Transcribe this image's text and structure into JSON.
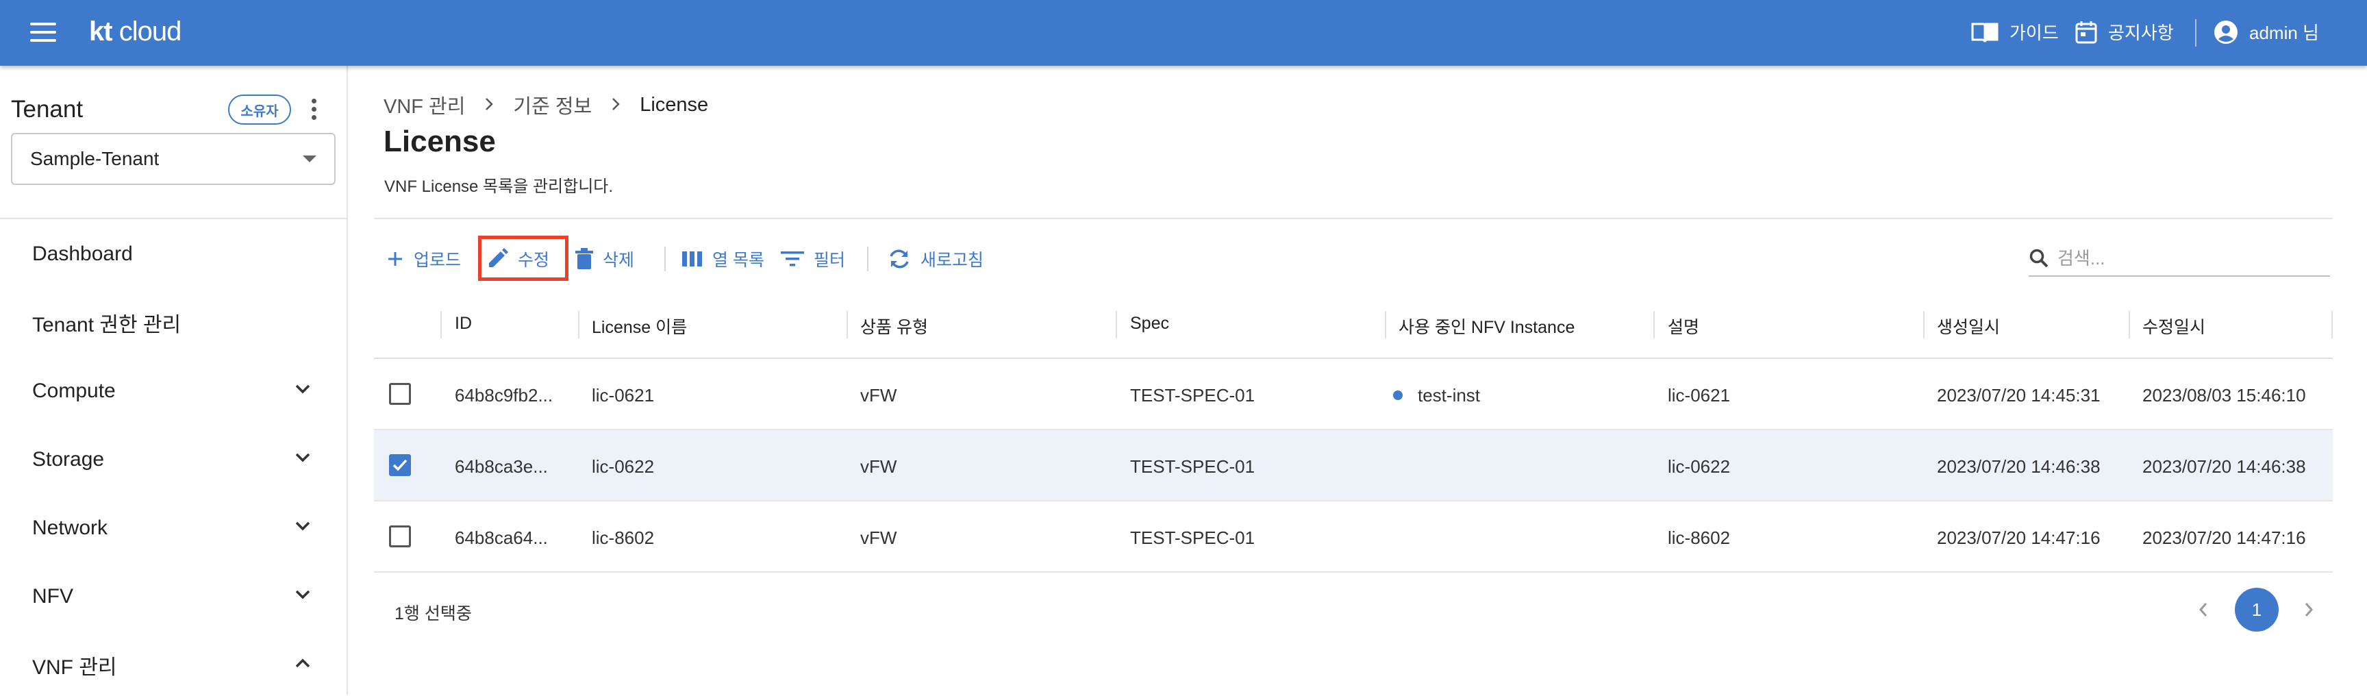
{
  "header": {
    "brand_bold": "kt",
    "brand_light": " cloud",
    "guide": "가이드",
    "notice": "공지사항",
    "user": "admin 님"
  },
  "sidebar": {
    "tenant_title": "Tenant",
    "owner_badge": "소유자",
    "tenant_selected": "Sample-Tenant",
    "items": [
      {
        "label": "Dashboard",
        "expandable": false
      },
      {
        "label": "Tenant 권한 관리",
        "expandable": false
      },
      {
        "label": "Compute",
        "expandable": true,
        "expanded": false
      },
      {
        "label": "Storage",
        "expandable": true,
        "expanded": false
      },
      {
        "label": "Network",
        "expandable": true,
        "expanded": false
      },
      {
        "label": "NFV",
        "expandable": true,
        "expanded": false
      },
      {
        "label": "VNF 관리",
        "expandable": true,
        "expanded": true
      }
    ]
  },
  "breadcrumb": {
    "level1": "VNF 관리",
    "level2": "기준 정보",
    "level3": "License"
  },
  "page": {
    "title": "License",
    "description": "VNF License 목록을 관리합니다."
  },
  "toolbar": {
    "upload": "업로드",
    "edit": "수정",
    "delete": "삭제",
    "columns": "열 목록",
    "filter": "필터",
    "refresh": "새로고침",
    "search_placeholder": "검색..."
  },
  "table": {
    "columns": [
      "ID",
      "License 이름",
      "상품 유형",
      "Spec",
      "사용 중인 NFV Instance",
      "설명",
      "생성일시",
      "수정일시"
    ],
    "rows": [
      {
        "checked": false,
        "id": "64b8c9fb2...",
        "name": "lic-0621",
        "type": "vFW",
        "spec": "TEST-SPEC-01",
        "instance": "test-inst",
        "desc": "lic-0621",
        "created": "2023/07/20 14:45:31",
        "modified": "2023/08/03 15:46:10"
      },
      {
        "checked": true,
        "id": "64b8ca3e...",
        "name": "lic-0622",
        "type": "vFW",
        "spec": "TEST-SPEC-01",
        "instance": "",
        "desc": "lic-0622",
        "created": "2023/07/20 14:46:38",
        "modified": "2023/07/20 14:46:38"
      },
      {
        "checked": false,
        "id": "64b8ca64...",
        "name": "lic-8602",
        "type": "vFW",
        "spec": "TEST-SPEC-01",
        "instance": "",
        "desc": "lic-8602",
        "created": "2023/07/20 14:47:16",
        "modified": "2023/07/20 14:47:16"
      }
    ]
  },
  "footer": {
    "selection": "1행 선택중",
    "current_page": "1"
  },
  "colors": {
    "primary": "#3f79cc",
    "highlight": "#e8412c",
    "selected_row": "#edf2f9"
  }
}
